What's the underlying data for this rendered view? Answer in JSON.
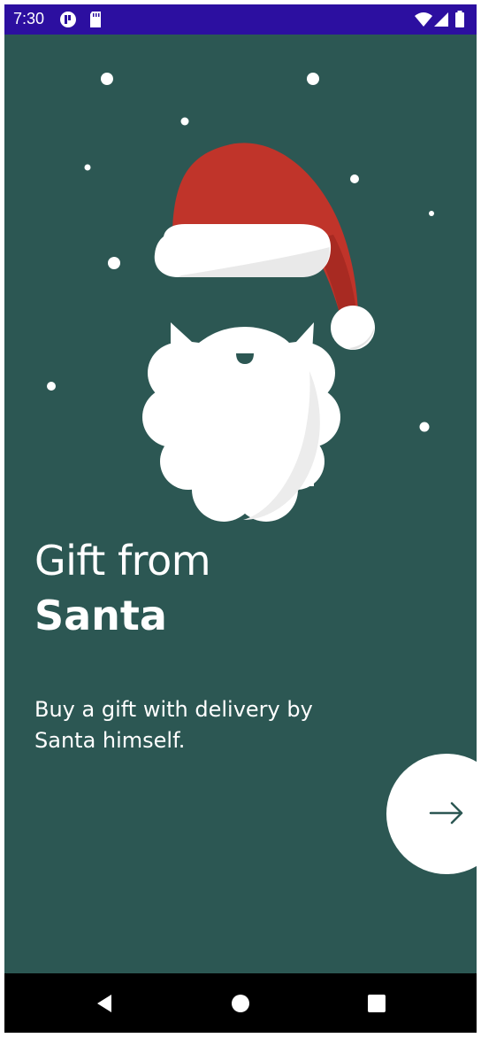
{
  "status_bar": {
    "time": "7:30",
    "icons": [
      "notification-icon",
      "sd-card-icon",
      "wifi-icon",
      "signal-icon",
      "battery-icon"
    ]
  },
  "onboarding": {
    "title_line1": "Gift from",
    "title_line2": "Santa",
    "subtitle": "Buy a gift with delivery by Santa himself.",
    "next_icon": "arrow-right-icon"
  },
  "navigation": {
    "buttons": [
      "back-icon",
      "home-icon",
      "recents-icon"
    ]
  },
  "colors": {
    "status_bar": "#2c0fa0",
    "background": "#2c5753",
    "hat_red": "#c0342a",
    "white": "#ffffff"
  }
}
